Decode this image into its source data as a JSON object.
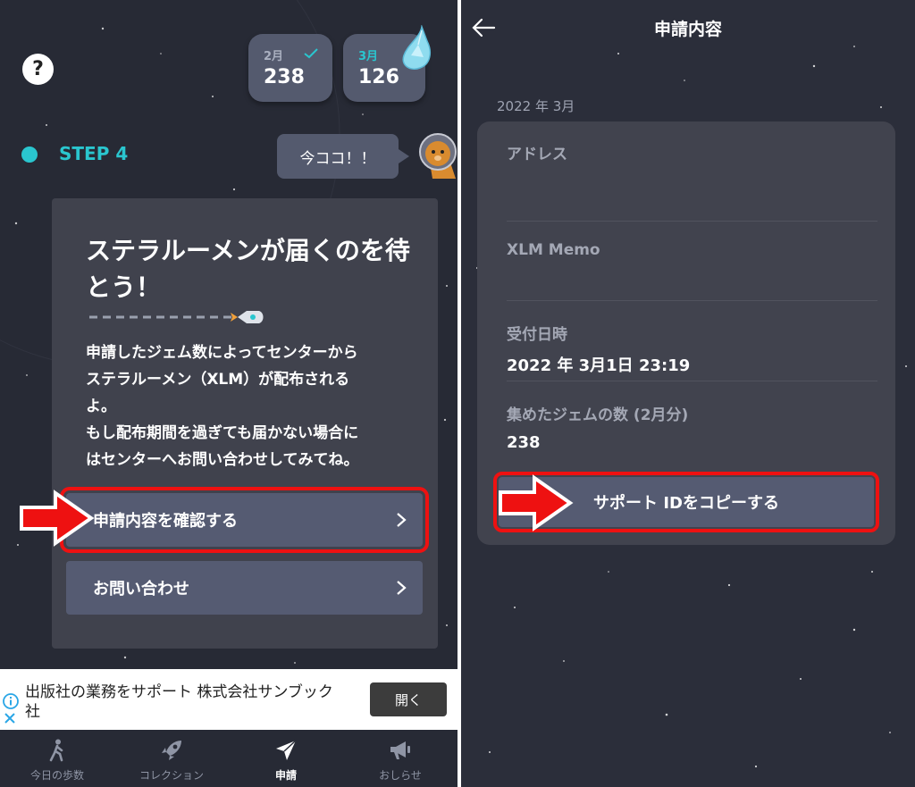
{
  "left": {
    "help_label": "?",
    "months": [
      {
        "label": "2月",
        "value": "238",
        "checked": true
      },
      {
        "label": "3月",
        "value": "126",
        "checked": false
      }
    ],
    "step_label": "STEP 4",
    "here_bubble": "今ココ！！",
    "card": {
      "title": "ステラルーメンが届くのを待とう！",
      "description": "申請したジェム数によってセンターから\nステラルーメン（XLM）が配布される\nよ。\nもし配布期間を過ぎても届かない場合に\nはセンターへお問い合わせしてみてね。",
      "confirm_button": "申請内容を確認する",
      "contact_button": "お問い合わせ"
    },
    "ad": {
      "text": "出版社の業務をサポート 株式会社サンブック社",
      "open_button": "開く"
    },
    "tabs": [
      {
        "label": "今日の歩数",
        "icon": "walking-icon",
        "active": false
      },
      {
        "label": "コレクション",
        "icon": "rocket-icon",
        "active": false
      },
      {
        "label": "申請",
        "icon": "paper-plane-icon",
        "active": true
      },
      {
        "label": "おしらせ",
        "icon": "megaphone-icon",
        "active": false
      }
    ]
  },
  "right": {
    "title": "申請内容",
    "month_header": "2022 年 3月",
    "fields": [
      {
        "label": "アドレス",
        "value": ""
      },
      {
        "label": "XLM Memo",
        "value": ""
      },
      {
        "label": "受付日時",
        "value": "2022 年 3月1日 23:19"
      },
      {
        "label": "集めたジェムの数 (2月分)",
        "value": "238"
      }
    ],
    "copy_button": "サポート IDをコピーする"
  },
  "colors": {
    "accent_teal": "#2ac6cf",
    "highlight_red": "#ee1111",
    "button_bg": "#555b72",
    "card_bg": "#40424d",
    "panel_bg": "#272a35"
  }
}
